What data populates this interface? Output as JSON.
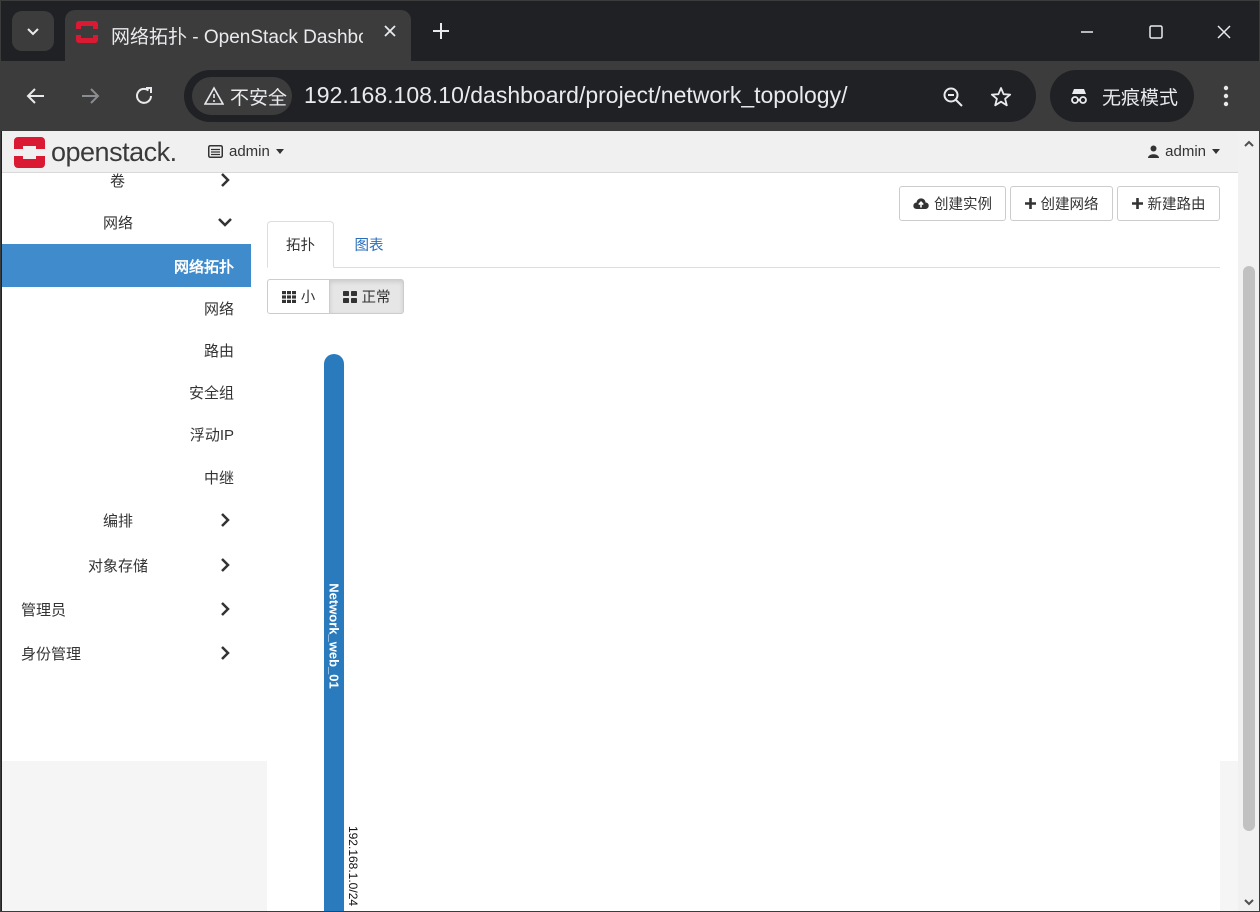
{
  "browser": {
    "tab_title": "网络拓扑 - OpenStack Dashboard",
    "address_security_label": "不安全",
    "url": "192.168.108.10/dashboard/project/network_topology/",
    "incognito_label": "无痕模式"
  },
  "header": {
    "logo_text": "openstack.",
    "project_selector": "admin",
    "user_menu": "admin"
  },
  "sidebar": {
    "volumes_label": "卷",
    "network_group_label": "网络",
    "network_items": [
      {
        "label": "网络拓扑",
        "active": true
      },
      {
        "label": "网络"
      },
      {
        "label": "路由"
      },
      {
        "label": "安全组"
      },
      {
        "label": "浮动IP"
      },
      {
        "label": "中继"
      }
    ],
    "orchestration_label": "编排",
    "object_store_label": "对象存储",
    "admin_label": "管理员",
    "identity_label": "身份管理"
  },
  "actions": {
    "launch_instance": "创建实例",
    "create_network": "创建网络",
    "create_router": "新建路由"
  },
  "tabs": {
    "topology": "拓扑",
    "graph": "图表"
  },
  "view_toggle": {
    "small": "小",
    "normal": "正常"
  },
  "topology": {
    "network_name": "Network_web_01",
    "subnet_cidr": "192.168.1.0/24",
    "network_color": "#2a7bbd"
  },
  "colors": {
    "accent": "#3f8bcb",
    "openstack_red": "#da1a32"
  }
}
